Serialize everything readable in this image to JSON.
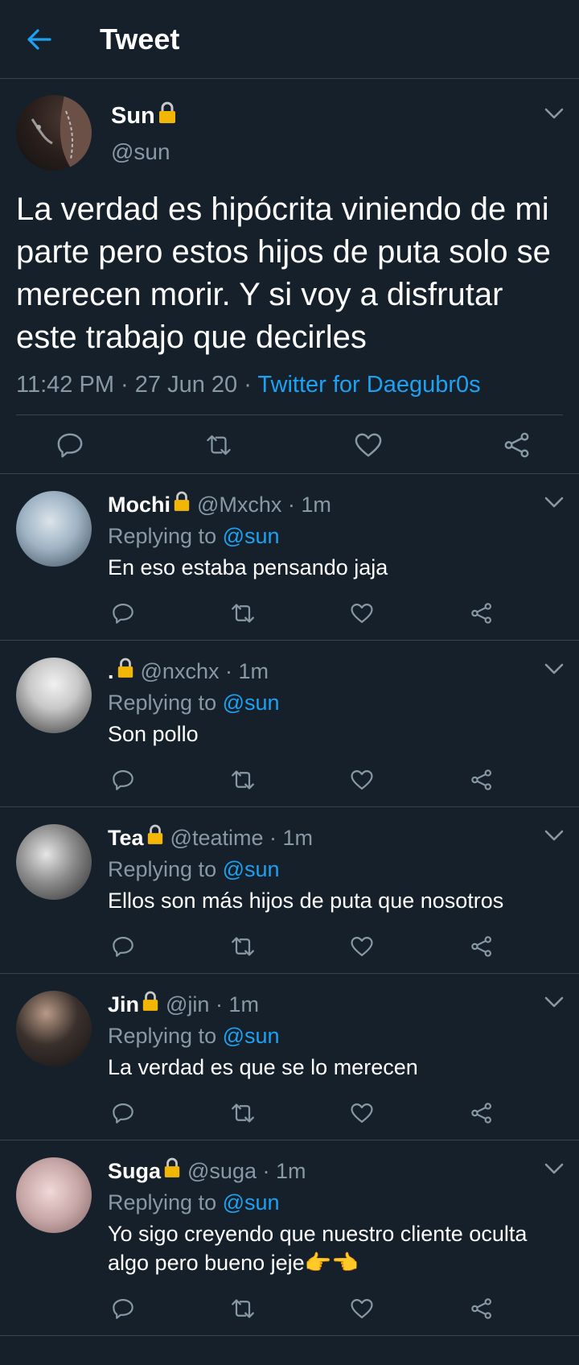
{
  "header": {
    "title": "Tweet"
  },
  "tweet": {
    "name": "Sun",
    "handle": "@sun",
    "text": "La verdad es hipócrita viniendo de mi parte pero estos hijos de puta solo se merecen morir. Y si voy a disfrutar este trabajo que decirles",
    "time": "11:42 PM",
    "date": "27 Jun 20",
    "source": "Twitter for Daegubr0s",
    "sep": " · "
  },
  "replies": [
    {
      "name": "Mochi",
      "handle": "@Mxchx",
      "time": "1m",
      "replying_label": "Replying to",
      "replying_to": "@sun",
      "text": "En eso estaba pensando jaja"
    },
    {
      "name": ".",
      "handle": "@nxchx",
      "time": "1m",
      "replying_label": "Replying to",
      "replying_to": "@sun",
      "text": "Son pollo"
    },
    {
      "name": "Tea",
      "handle": "@teatime",
      "time": "1m",
      "replying_label": "Replying to",
      "replying_to": "@sun",
      "text": "Ellos son más hijos de puta que nosotros"
    },
    {
      "name": "Jin",
      "handle": "@jin",
      "time": "1m",
      "replying_label": "Replying to",
      "replying_to": "@sun",
      "text": "La verdad es que se lo merecen"
    },
    {
      "name": "Suga",
      "handle": "@suga",
      "time": "1m",
      "replying_label": "Replying to",
      "replying_to": "@sun",
      "text": "Yo sigo creyendo que nuestro cliente oculta algo pero bueno jeje👉👈"
    }
  ],
  "colors": {
    "background": "#15202b",
    "accent": "#1da1f2",
    "muted": "#8899a6",
    "divider": "#38444d"
  },
  "icons": [
    "back-arrow-icon",
    "lock-icon",
    "chevron-down-icon",
    "reply-icon",
    "retweet-icon",
    "like-icon",
    "share-icon"
  ]
}
